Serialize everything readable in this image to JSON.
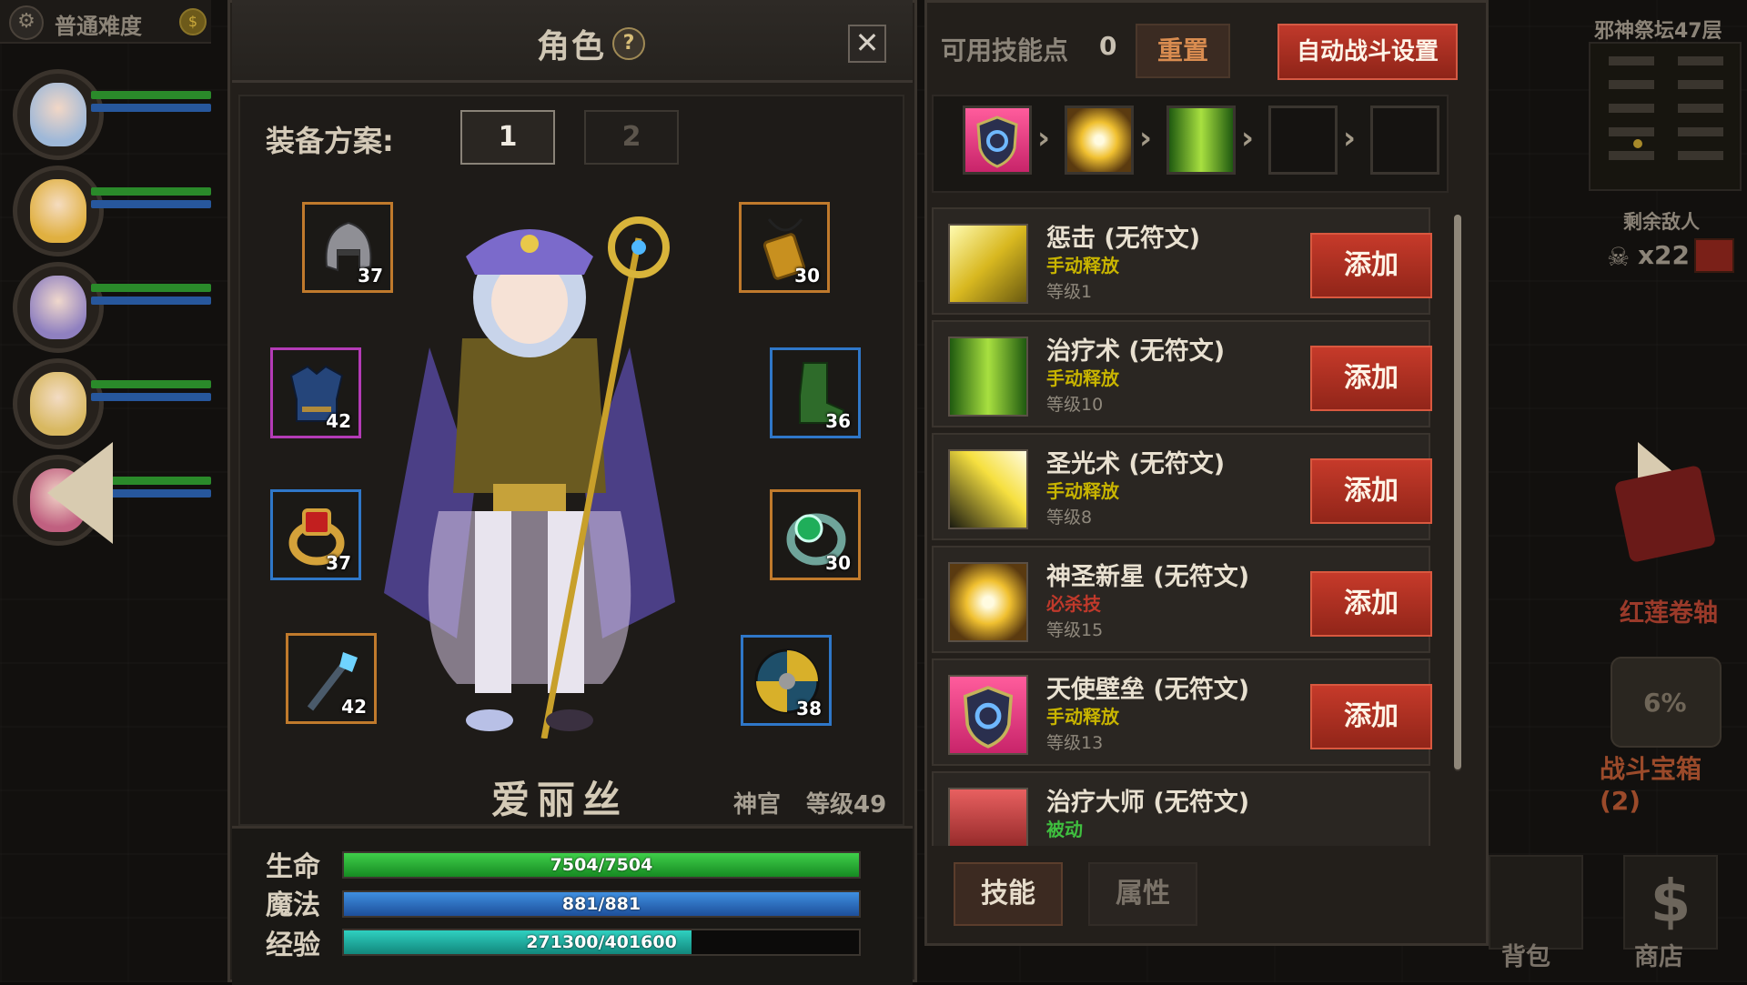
{
  "top_left": {
    "difficulty": "普通难度"
  },
  "panel": {
    "title": "角色",
    "help": "?",
    "close": "✕",
    "plan_label": "装备方案:",
    "plans": [
      "1",
      "2"
    ],
    "equipment": [
      {
        "slot": "helmet",
        "level": "37",
        "rarity": "orange"
      },
      {
        "slot": "armor",
        "level": "42",
        "rarity": "purple"
      },
      {
        "slot": "ring-left",
        "level": "37",
        "rarity": "blue"
      },
      {
        "slot": "weapon",
        "level": "42",
        "rarity": "orange"
      },
      {
        "slot": "amulet",
        "level": "30",
        "rarity": "orange"
      },
      {
        "slot": "boots",
        "level": "36",
        "rarity": "blue"
      },
      {
        "slot": "ring-right",
        "level": "30",
        "rarity": "orange"
      },
      {
        "slot": "shield",
        "level": "38",
        "rarity": "blue"
      }
    ],
    "character": {
      "name": "爱丽丝",
      "class": "神官",
      "level": "等级49"
    },
    "stats": {
      "hp_label": "生命",
      "hp": "7504/7504",
      "hp_ratio": 1.0,
      "mp_label": "魔法",
      "mp": "881/881",
      "mp_ratio": 1.0,
      "xp_label": "经验",
      "xp": "271300/401600",
      "xp_ratio": 0.6755
    }
  },
  "skills_panel": {
    "points_label": "可用技能点",
    "points": "0",
    "reset": "重置",
    "auto_battle": "自动战斗设置",
    "skills": [
      {
        "name": "惩击 (无符文)",
        "type": "手动释放",
        "type_color": "#c8b400",
        "level": "等级1",
        "add": "添加"
      },
      {
        "name": "治疗术 (无符文)",
        "type": "手动释放",
        "type_color": "#c8b400",
        "level": "等级10",
        "add": "添加"
      },
      {
        "name": "圣光术 (无符文)",
        "type": "手动释放",
        "type_color": "#c8b400",
        "level": "等级8",
        "add": "添加"
      },
      {
        "name": "神圣新星 (无符文)",
        "type": "必杀技",
        "type_color": "#c0392b",
        "level": "等级15",
        "add": "添加"
      },
      {
        "name": "天使壁垒 (无符文)",
        "type": "手动释放",
        "type_color": "#c8b400",
        "level": "等级13",
        "add": "添加"
      },
      {
        "name": "治疗大师 (无符文)",
        "type": "被动",
        "type_color": "#3fbf3f",
        "level": "",
        "add": ""
      }
    ],
    "tabs": [
      "技能",
      "属性"
    ]
  },
  "hud": {
    "floor": "邪神祭坛47层",
    "enemies_label": "剩余敌人",
    "enemies": "x22",
    "scroll_item": "红莲卷轴",
    "chest_pct": "6%",
    "chest_label": "战斗宝箱 (2)",
    "bag": "背包",
    "shop": "商店",
    "shop_symbol": "$"
  }
}
